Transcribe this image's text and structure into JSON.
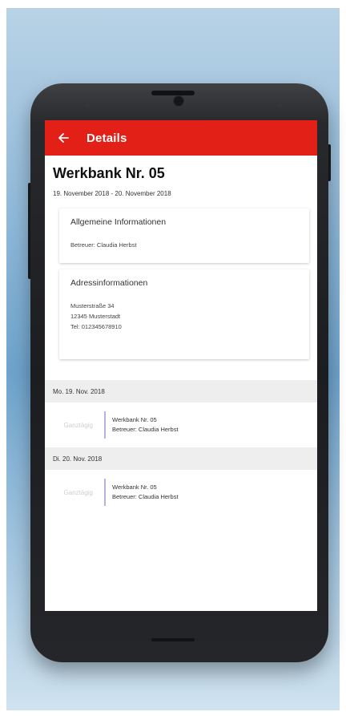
{
  "appbar": {
    "title": "Details"
  },
  "details": {
    "title": "Werkbank Nr. 05",
    "date_range": "19. November 2018 - 20. November 2018"
  },
  "cards": {
    "general": {
      "title": "Allgemeine Informationen",
      "supervisor": "Betreuer: Claudia Herbst"
    },
    "address": {
      "title": "Adressinformationen",
      "street": "Musterstraße 34",
      "city": "12345 Musterstadt",
      "phone": "Tel: 012345678910"
    }
  },
  "days": [
    {
      "header": "Mo. 19. Nov. 2018",
      "time_label": "Ganztägig",
      "entry_title": "Werkbank Nr. 05",
      "entry_supervisor": "Betreuer: Claudia Herbst"
    },
    {
      "header": "Di. 20. Nov. 2018",
      "time_label": "Ganztägig",
      "entry_title": "Werkbank Nr. 05",
      "entry_supervisor": "Betreuer: Claudia Herbst"
    }
  ],
  "colors": {
    "appbar": "#e32017",
    "timeline_accent": "#b6b1e0",
    "day_header_bg": "#eeeeee"
  },
  "icons": {
    "back": "arrow-left-icon"
  }
}
